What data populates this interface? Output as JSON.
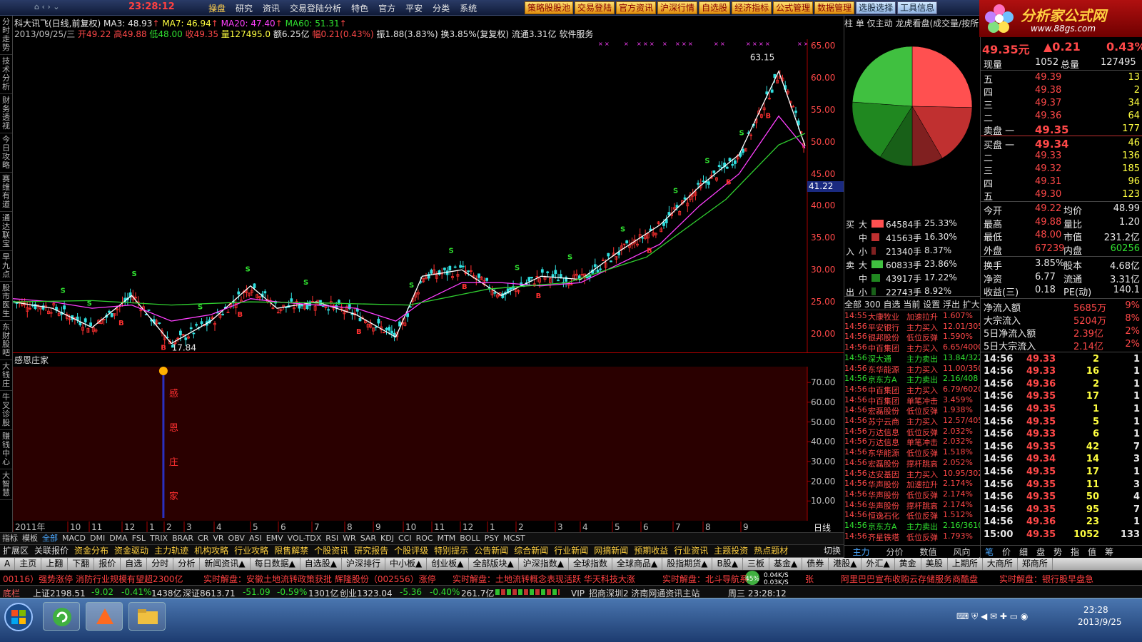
{
  "topbar": {
    "clock": "23:28:12",
    "menu": [
      "操盘",
      "研究",
      "资讯",
      "交易登陆分析",
      "特色",
      "官方",
      "平安",
      "分类",
      "系统"
    ],
    "menu2": [
      "策略股股池",
      "交易登陆",
      "官方资讯",
      "沪深行情",
      "自选股",
      "经济指标",
      "公式管理",
      "数据管理",
      "选股选择",
      "工具信息"
    ]
  },
  "logo": {
    "title": "分析家公式网",
    "url": "www.88gs.com"
  },
  "vtabs": [
    "分时走势",
    "技术分析",
    "财务透视",
    "今日攻略",
    "赛维有道",
    "通达联宝",
    "早九点",
    "股市医生",
    "东财股吧",
    "大钱庄",
    "牛叉诊股",
    "赚钱中心",
    "大智慧"
  ],
  "header": {
    "line1": {
      "name": "科大讯飞(日线,前复权)",
      "ma3": "MA3: 48.93",
      "ma7": "MA7: 46.94",
      "ma20": "MA20: 47.40",
      "ma60": "MA60: 51.31"
    },
    "line2": {
      "date": "2013/09/25/三",
      "open": "开49.22",
      "high": "高49.88",
      "low": "低48.00",
      "close": "收49.35",
      "vol": "量127495.0",
      "amt": "额6.25亿",
      "chg": "幅0.21(0.43%)",
      "rest": "振1.88(3.83%) 换3.85%(复复权) 流通3.31亿 软件服务"
    }
  },
  "chart_data": {
    "type": "line",
    "title": "科大讯飞(日线,前复权)",
    "ylim": [
      17,
      66
    ],
    "y_ticks": [
      20,
      25,
      30,
      35,
      40,
      45,
      50,
      55,
      60,
      65
    ],
    "x_labels": [
      "2011年",
      "10",
      "11",
      "12",
      "1",
      "2",
      "3",
      "4",
      "5",
      "6",
      "7",
      "8",
      "9",
      "10",
      "11",
      "12",
      "1",
      "2",
      "3",
      "4",
      "5",
      "6",
      "7",
      "8",
      "9"
    ],
    "series": [
      {
        "name": "MA3",
        "x": [
          0,
          15,
          30,
          45,
          60,
          75,
          90,
          100,
          115,
          130,
          145,
          155,
          170,
          185,
          200,
          215,
          230,
          245,
          260,
          275,
          290,
          300
        ],
        "values": [
          25,
          24,
          21,
          26,
          18.5,
          22,
          27.5,
          24,
          25,
          23,
          19.5,
          29,
          30,
          26,
          29,
          28.5,
          33,
          37,
          43,
          48,
          61,
          49.35
        ]
      },
      {
        "name": "MA20",
        "x": [
          0,
          15,
          30,
          45,
          60,
          75,
          90,
          100,
          115,
          130,
          145,
          155,
          170,
          185,
          200,
          215,
          230,
          245,
          260,
          275,
          290,
          300
        ],
        "values": [
          25.5,
          25,
          24,
          24.5,
          22,
          23,
          25.5,
          25,
          24.5,
          24,
          22,
          25,
          28,
          28,
          27.5,
          28,
          31,
          34,
          40,
          45,
          54,
          49
        ]
      },
      {
        "name": "MA60",
        "x": [
          0,
          30,
          60,
          90,
          120,
          150,
          180,
          210,
          240,
          270,
          290,
          300
        ],
        "values": [
          25,
          25.2,
          24.5,
          25,
          24.8,
          24.5,
          27,
          28,
          32,
          41,
          49.5,
          51.3
        ]
      }
    ],
    "annotations": [
      {
        "text": "63.15",
        "x": 277,
        "y": 63.15
      },
      {
        "text": "17.84",
        "x": 58,
        "y": 17.84
      }
    ],
    "current_price": "41.22",
    "indicator": {
      "name": "感恩庄家",
      "label": "感恩庄家",
      "y_ticks": [
        10,
        20,
        30,
        40,
        50,
        60,
        70
      ],
      "ylim": [
        0,
        78
      ],
      "signal_x": 57
    }
  },
  "ind_axis_labels": [
    "70.00",
    "60.00",
    "50.00",
    "40.00",
    "30.00",
    "20.00",
    "10.00"
  ],
  "price_axis_labels": [
    "65.00",
    "60.00",
    "55.00",
    "50.00",
    "45.00",
    "40.00",
    "35.00",
    "30.00",
    "25.00",
    "20.00"
  ],
  "timeaxis_right": "日线",
  "tabs1": [
    "指标",
    "模板",
    "全部",
    "MACD",
    "DMI",
    "DMA",
    "FSL",
    "TRIX",
    "BRAR",
    "CR",
    "VR",
    "OBV",
    "ASI",
    "EMV",
    "VOL-TDX",
    "RSI",
    "WR",
    "SAR",
    "KDJ",
    "CCI",
    "ROC",
    "MTM",
    "BOLL",
    "PSY",
    "MCST"
  ],
  "tabs2": [
    "扩展区",
    "关联报价",
    "资金分布",
    "资金驱动",
    "主力轨迹",
    "机构攻略",
    "行业攻略",
    "限售解禁",
    "个股资讯",
    "研究报告",
    "个股评级",
    "特别提示",
    "公告新闻",
    "综合新闻",
    "行业新闻",
    "网摘新闻",
    "预期收益",
    "行业资讯",
    "主题投资",
    "热点题材"
  ],
  "tabs3": [
    "A",
    "主页",
    "上翻",
    "下翻",
    "报价",
    "自选",
    "分时",
    "分析",
    "新闻资讯▲",
    "每日数据▲",
    "自选股▲",
    "沪深排行",
    "中小板▲",
    "创业板▲",
    "全部版块▲",
    "沪深指数▲",
    "全球指数",
    "全球商品▲",
    "股指期货▲",
    "B股▲",
    "三板",
    "基金▲",
    "债券",
    "港股▲",
    "外汇▲",
    "黄金",
    "美股",
    "上期所",
    "大商所",
    "郑商所"
  ],
  "tabs_extra": {
    "cut": "切换",
    "main": "主力",
    "split": "分价",
    "data": "数值",
    "wind": "风向"
  },
  "ticker": [
    "00116）强势涨停 消防行业规模有望超2300亿",
    "实时解盘：安徽土地流转政策获批 辉隆股份（002556）涨停",
    "实时解盘：土地流转概念表现活跃 华天科技大涨",
    "实时解盘：北斗导航系",
    "张",
    "阿里巴巴宣布收购云存储服务商酷盘",
    "实时解盘：银行股早盘急"
  ],
  "netspeed": {
    "pct": "45%",
    "up": "0.04K/S",
    "down": "0.03K/S"
  },
  "indexbar": {
    "sh": "上证2198.51",
    "sh_chg": "-9.02",
    "sh_pct": "-0.41%",
    "sh_amt": "1438亿",
    "sz": "深证8613.71",
    "sz_chg": "-51.09",
    "sz_pct": "-0.59%",
    "sz_amt": "1301亿",
    "cy": "创业1323.04",
    "cy_chg": "-5.36",
    "cy_pct": "-0.40%",
    "cy_amt": "261.7亿",
    "site": "VIP_招商深圳2 济南网通资讯主站",
    "time": "周三 23:28:12",
    "label": "底栏"
  },
  "taskbar": {
    "time": "23:28",
    "date": "2013/9/25"
  },
  "rp1": {
    "header": "柱 单 仅主动 龙虎看盘(成交量/按所",
    "pie": [
      {
        "v": 25.33,
        "c": "#ff5050"
      },
      {
        "v": 16.3,
        "c": "#c03030"
      },
      {
        "v": 8.37,
        "c": "#802020"
      },
      {
        "v": 8.92,
        "c": "#186018"
      },
      {
        "v": 17.22,
        "c": "#208820"
      },
      {
        "v": 23.86,
        "c": "#40c040"
      }
    ],
    "flows": [
      {
        "side": "买",
        "size": "大",
        "amt": "64584手",
        "pct": "25.33%",
        "color": "#ff5050",
        "w": 34
      },
      {
        "side": "",
        "size": "中",
        "amt": "41563手",
        "pct": "16.30%",
        "color": "#c03030",
        "w": 22
      },
      {
        "side": "入",
        "size": "小",
        "amt": "21340手",
        "pct": "8.37%",
        "color": "#802020",
        "w": 11
      },
      {
        "side": "卖",
        "size": "大",
        "amt": "60833手",
        "pct": "23.86%",
        "color": "#40c040",
        "w": 32
      },
      {
        "side": "",
        "size": "中",
        "amt": "43917手",
        "pct": "17.22%",
        "color": "#208820",
        "w": 23
      },
      {
        "side": "出",
        "size": "小",
        "amt": "22743手",
        "pct": "8.92%",
        "color": "#186018",
        "w": 12
      }
    ],
    "fltabs": "全部 300 自选 当前 设置 浮出 扩大",
    "news": [
      {
        "t": "14:55",
        "n": "大康牧业",
        "a": "加速拉升",
        "v": "1.607%",
        "c": "red"
      },
      {
        "t": "14:56",
        "n": "平安银行",
        "a": "主力买入",
        "v": "12.01/305",
        "c": "red"
      },
      {
        "t": "14:56",
        "n": "银邦股份",
        "a": "低位反弹",
        "v": "1.590%",
        "c": "red"
      },
      {
        "t": "14:56",
        "n": "中百集团",
        "a": "主力买入",
        "v": "6.65/4000",
        "c": "red"
      },
      {
        "t": "14:56",
        "n": "深大通",
        "a": "主力卖出",
        "v": "13.84/322",
        "c": "grn"
      },
      {
        "t": "14:56",
        "n": "东华能源",
        "a": "主力买入",
        "v": "11.00/350",
        "c": "red"
      },
      {
        "t": "14:56",
        "n": "京东方A",
        "a": "主力卖出",
        "v": "2.16/408",
        "c": "grn"
      },
      {
        "t": "14:56",
        "n": "中百集团",
        "a": "主力买入",
        "v": "6.79/6020",
        "c": "red"
      },
      {
        "t": "14:56",
        "n": "中百集团",
        "a": "单笔冲击",
        "v": "3.459%",
        "c": "red"
      },
      {
        "t": "14:56",
        "n": "宏磊股份",
        "a": "低位反弹",
        "v": "1.938%",
        "c": "red"
      },
      {
        "t": "14:56",
        "n": "苏宁云商",
        "a": "主力买入",
        "v": "12.57/405",
        "c": "red"
      },
      {
        "t": "14:56",
        "n": "万达信息",
        "a": "低位反弹",
        "v": "2.032%",
        "c": "red"
      },
      {
        "t": "14:56",
        "n": "万达信息",
        "a": "单笔冲击",
        "v": "2.032%",
        "c": "red"
      },
      {
        "t": "14:56",
        "n": "东华能源",
        "a": "低位反弹",
        "v": "1.518%",
        "c": "red"
      },
      {
        "t": "14:56",
        "n": "宏磊股份",
        "a": "撑杆跳高",
        "v": "2.052%",
        "c": "red"
      },
      {
        "t": "14:56",
        "n": "达安基因",
        "a": "主力买入",
        "v": "10.95/302",
        "c": "red"
      },
      {
        "t": "14:56",
        "n": "华声股份",
        "a": "加速拉升",
        "v": "2.174%",
        "c": "red"
      },
      {
        "t": "14:56",
        "n": "华声股份",
        "a": "低位反弹",
        "v": "2.174%",
        "c": "red"
      },
      {
        "t": "14:56",
        "n": "华声股份",
        "a": "撑杆跳高",
        "v": "2.174%",
        "c": "red"
      },
      {
        "t": "14:56",
        "n": "恒逸石化",
        "a": "低位反弹",
        "v": "1.512%",
        "c": "red"
      },
      {
        "t": "14:56",
        "n": "京东方A",
        "a": "主力卖出",
        "v": "2.16/3610",
        "c": "grn"
      },
      {
        "t": "14:56",
        "n": "齐星铁塔",
        "a": "低位反弹",
        "v": "1.793%",
        "c": "red"
      }
    ]
  },
  "rp2": {
    "price": "49.35元",
    "chg": "▲0.21",
    "pct": "0.43%",
    "now_lbl": "现量",
    "now": "1052",
    "total_lbl": "总量",
    "total": "127495",
    "asks": [
      {
        "l": "五",
        "p": "49.39",
        "v": "13"
      },
      {
        "l": "四",
        "p": "49.38",
        "v": "2"
      },
      {
        "l": "三",
        "p": "49.37",
        "v": "34"
      },
      {
        "l": "二",
        "p": "49.36",
        "v": "64"
      },
      {
        "l": "卖盘 一",
        "p": "49.35",
        "v": "177"
      }
    ],
    "bids": [
      {
        "l": "买盘 一",
        "p": "49.34",
        "v": "46"
      },
      {
        "l": "二",
        "p": "49.33",
        "v": "136"
      },
      {
        "l": "三",
        "p": "49.32",
        "v": "185"
      },
      {
        "l": "四",
        "p": "49.31",
        "v": "96"
      },
      {
        "l": "五",
        "p": "49.30",
        "v": "123"
      }
    ],
    "stats": [
      [
        "今开",
        "49.22",
        "均价",
        "48.99"
      ],
      [
        "最高",
        "49.88",
        "量比",
        "1.20"
      ],
      [
        "最低",
        "48.00",
        "市值",
        "231.2亿"
      ],
      [
        "外盘",
        "67239",
        "内盘",
        "60256"
      ]
    ],
    "stats2": [
      [
        "换手",
        "3.85%",
        "股本",
        "4.68亿"
      ],
      [
        "净资",
        "6.77",
        "流通",
        "3.31亿"
      ],
      [
        "收益(三)",
        "0.18",
        "PE(动)",
        "140.1"
      ]
    ],
    "money": [
      [
        "净流入额",
        "5685万",
        "9%"
      ],
      [
        "大宗流入",
        "5204万",
        "8%"
      ],
      [
        "5日净流入额",
        "2.39亿",
        "2%"
      ],
      [
        "5日大宗流入",
        "2.14亿",
        "2%"
      ]
    ],
    "ticks": [
      [
        "14:56",
        "49.33",
        "2",
        "1"
      ],
      [
        "14:56",
        "49.33",
        "16",
        "1"
      ],
      [
        "14:56",
        "49.36",
        "2",
        "1"
      ],
      [
        "14:56",
        "49.35",
        "17",
        "1"
      ],
      [
        "14:56",
        "49.35",
        "1",
        "1"
      ],
      [
        "14:56",
        "49.35",
        "5",
        "1"
      ],
      [
        "14:56",
        "49.33",
        "6",
        "1"
      ],
      [
        "14:56",
        "49.35",
        "42",
        "7"
      ],
      [
        "14:56",
        "49.34",
        "14",
        "3"
      ],
      [
        "14:56",
        "49.35",
        "17",
        "1"
      ],
      [
        "14:56",
        "49.35",
        "11",
        "3"
      ],
      [
        "14:56",
        "49.35",
        "50",
        "4"
      ],
      [
        "14:56",
        "49.35",
        "95",
        "7"
      ],
      [
        "14:56",
        "49.36",
        "23",
        "1"
      ],
      [
        "15:00",
        "49.35",
        "1052",
        "133"
      ]
    ],
    "tabs": [
      "笔",
      "价",
      "细",
      "盘",
      "势",
      "指",
      "值",
      "筹"
    ]
  }
}
